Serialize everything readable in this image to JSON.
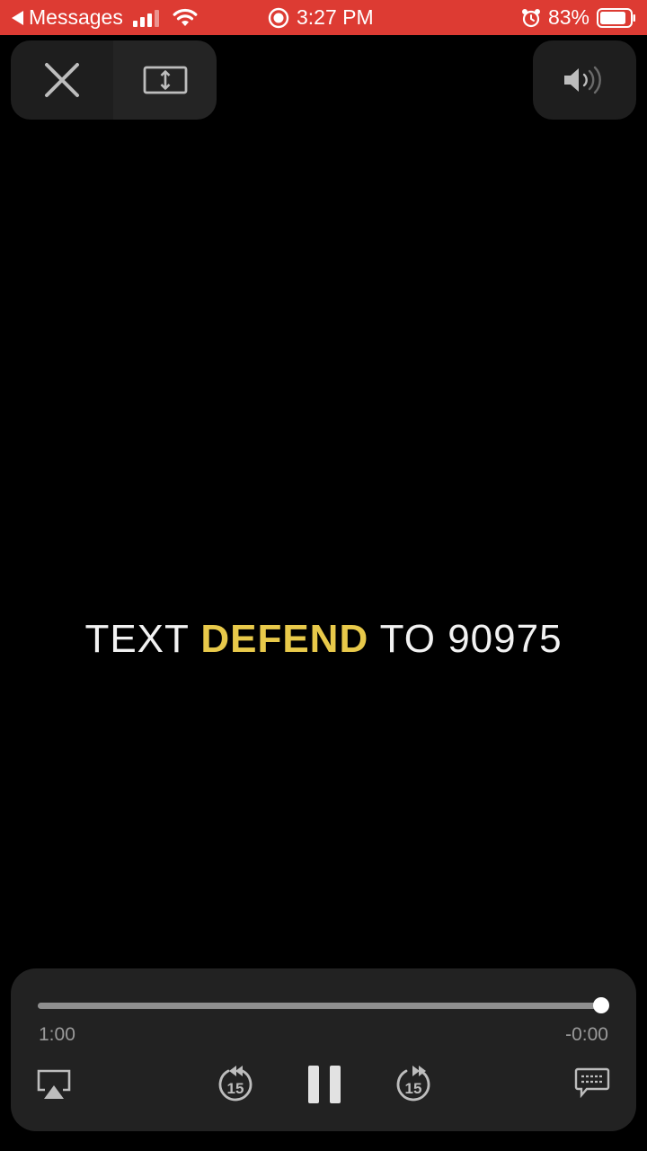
{
  "status_bar": {
    "back_app": "Messages",
    "time": "3:27 PM",
    "battery": "83%",
    "colors": {
      "background": "#dd3b33",
      "text": "#ffffff"
    }
  },
  "top_controls": {
    "close_icon": "close-icon",
    "resize_icon": "resize-icon",
    "volume_icon": "speaker-icon"
  },
  "video": {
    "caption_before": "TEXT ",
    "caption_highlight": "DEFEND",
    "caption_after": " TO 90975",
    "colors": {
      "text": "#f2f2f2",
      "highlight": "#e8c94a"
    }
  },
  "playback": {
    "elapsed": "1:00",
    "remaining": "-0:00",
    "progress_fraction": 1.0,
    "skip_back_seconds": "15",
    "skip_forward_seconds": "15"
  }
}
